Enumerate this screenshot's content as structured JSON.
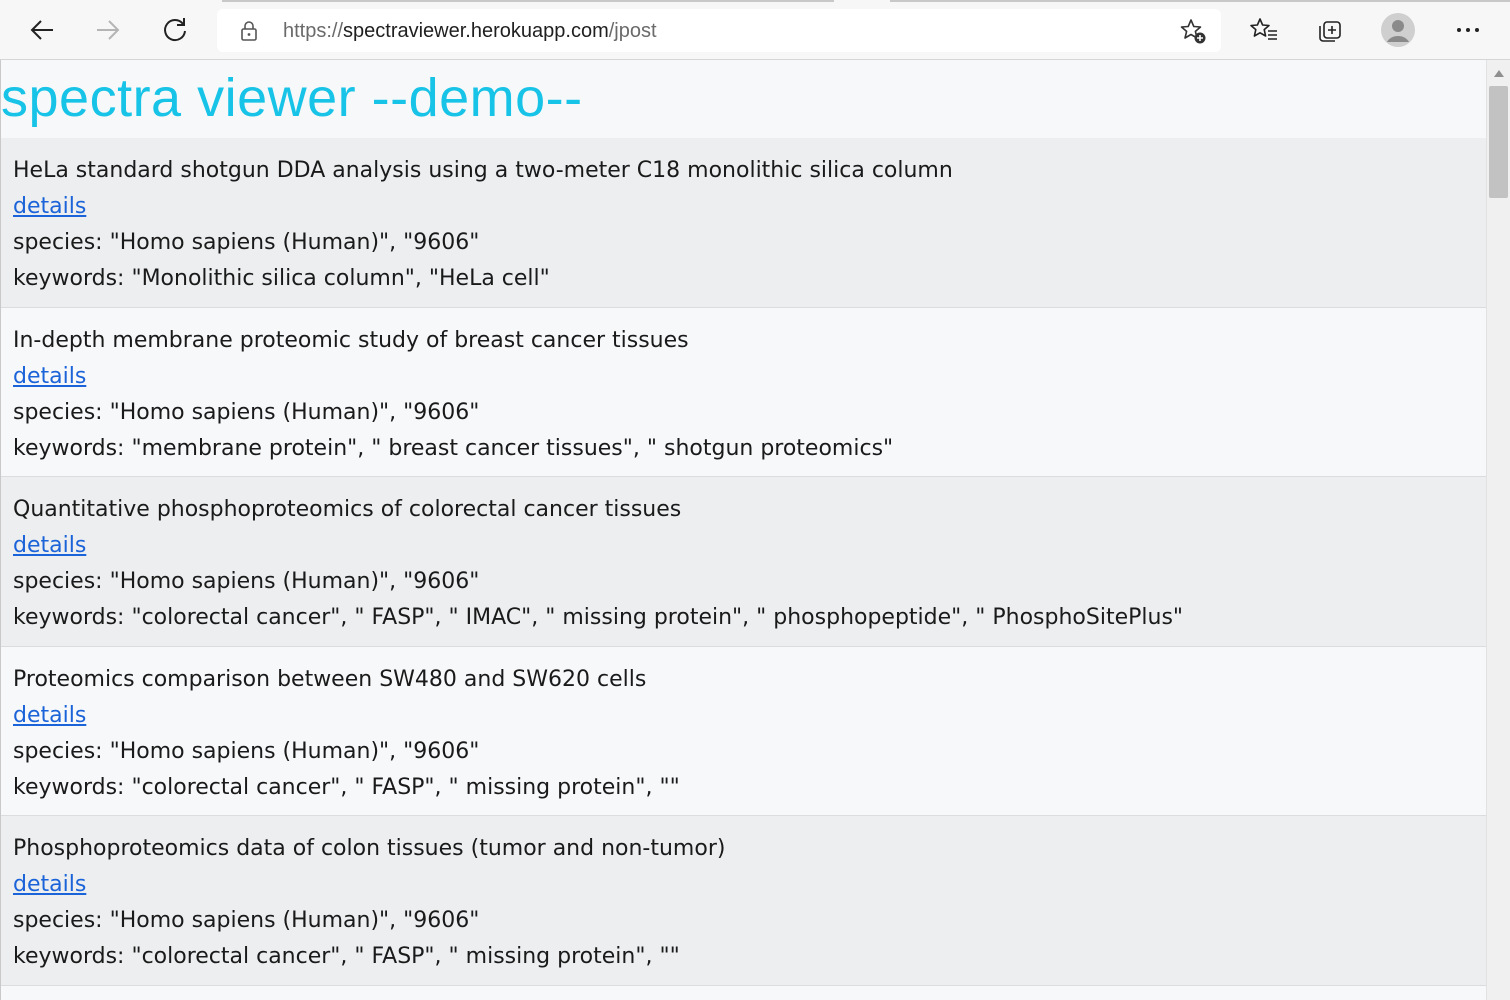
{
  "browser": {
    "url_protocol": "https://",
    "url_host": "spectraviewer.herokuapp.com",
    "url_path": "/jpost",
    "icons": [
      "back-icon",
      "forward-icon",
      "refresh-icon",
      "lock-icon",
      "add-favorite-icon",
      "favorites-icon",
      "collections-icon",
      "profile-avatar",
      "more-options-icon"
    ]
  },
  "page": {
    "title": "spectra viewer --demo--",
    "title_color": "#17c3e6",
    "link_color": "#1a63d8"
  },
  "entries": [
    {
      "title": "HeLa standard shotgun DDA analysis using a two-meter C18 monolithic silica column",
      "link": "details",
      "species": "species: \"Homo sapiens (Human)\", \"9606\"",
      "keywords": "keywords: \"Monolithic silica column\", \"HeLa cell\""
    },
    {
      "title": "In-depth membrane proteomic study of breast cancer tissues",
      "link": "details",
      "species": "species: \"Homo sapiens (Human)\", \"9606\"",
      "keywords": "keywords: \"membrane protein\", \" breast cancer tissues\", \" shotgun proteomics\""
    },
    {
      "title": "Quantitative phosphoproteomics of colorectal cancer tissues",
      "link": "details",
      "species": "species: \"Homo sapiens (Human)\", \"9606\"",
      "keywords": "keywords: \"colorectal cancer\", \" FASP\", \" IMAC\", \" missing protein\", \" phosphopeptide\", \" PhosphoSitePlus\""
    },
    {
      "title": "Proteomics comparison between SW480 and SW620 cells",
      "link": "details",
      "species": "species: \"Homo sapiens (Human)\", \"9606\"",
      "keywords": "keywords: \"colorectal cancer\", \" FASP\", \" missing protein\", \"\""
    },
    {
      "title": "Phosphoproteomics data of colon tissues (tumor and non-tumor)",
      "link": "details",
      "species": "species: \"Homo sapiens (Human)\", \"9606\"",
      "keywords": "keywords: \"colorectal cancer\", \" FASP\", \" missing protein\", \"\""
    }
  ]
}
